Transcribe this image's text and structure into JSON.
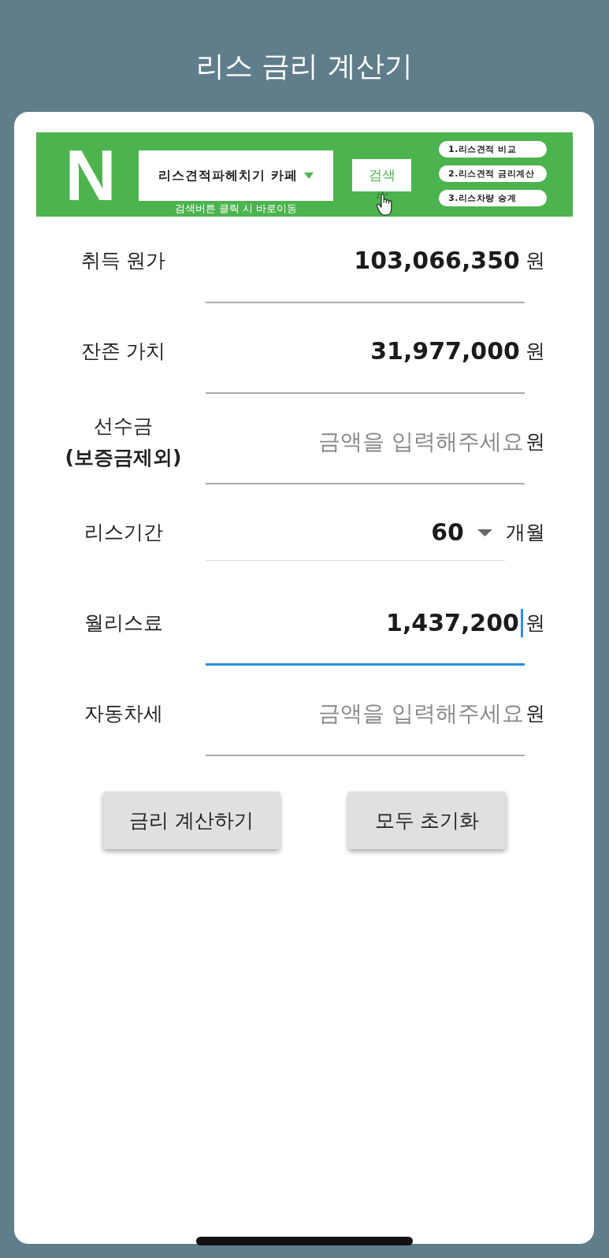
{
  "header": {
    "title": "리스 금리 계산기"
  },
  "banner": {
    "logo": "N",
    "select": {
      "value": "리스견적파헤치기 카페"
    },
    "hint": "검색버튼 클릭 시 바로이동",
    "search_button": "검색",
    "links": [
      "1.리스견적 비교",
      "2.리스견적 금리계산",
      "3.리스차량 승계"
    ]
  },
  "fields": [
    {
      "kind": "amount",
      "label": "취득 원가",
      "value": "103,066,350",
      "unit": "원",
      "focused": false
    },
    {
      "kind": "amount",
      "label": "잔존 가치",
      "value": "31,977,000",
      "unit": "원",
      "focused": false
    },
    {
      "kind": "amount",
      "label": "선수금",
      "note": "(보증금제외)",
      "placeholder": "금액을 입력해주세요",
      "unit": "원",
      "focused": false
    },
    {
      "kind": "select",
      "label": "리스기간",
      "value": "60",
      "unit": "개월",
      "focused": false
    },
    {
      "kind": "amount",
      "label": "월리스료",
      "value": "1,437,200",
      "unit": "원",
      "focused": true
    },
    {
      "kind": "amount",
      "label": "자동차세",
      "placeholder": "금액을 입력해주세요",
      "unit": "원",
      "focused": false
    }
  ],
  "buttons": [
    "금리 계산하기",
    "모두 초기화"
  ]
}
